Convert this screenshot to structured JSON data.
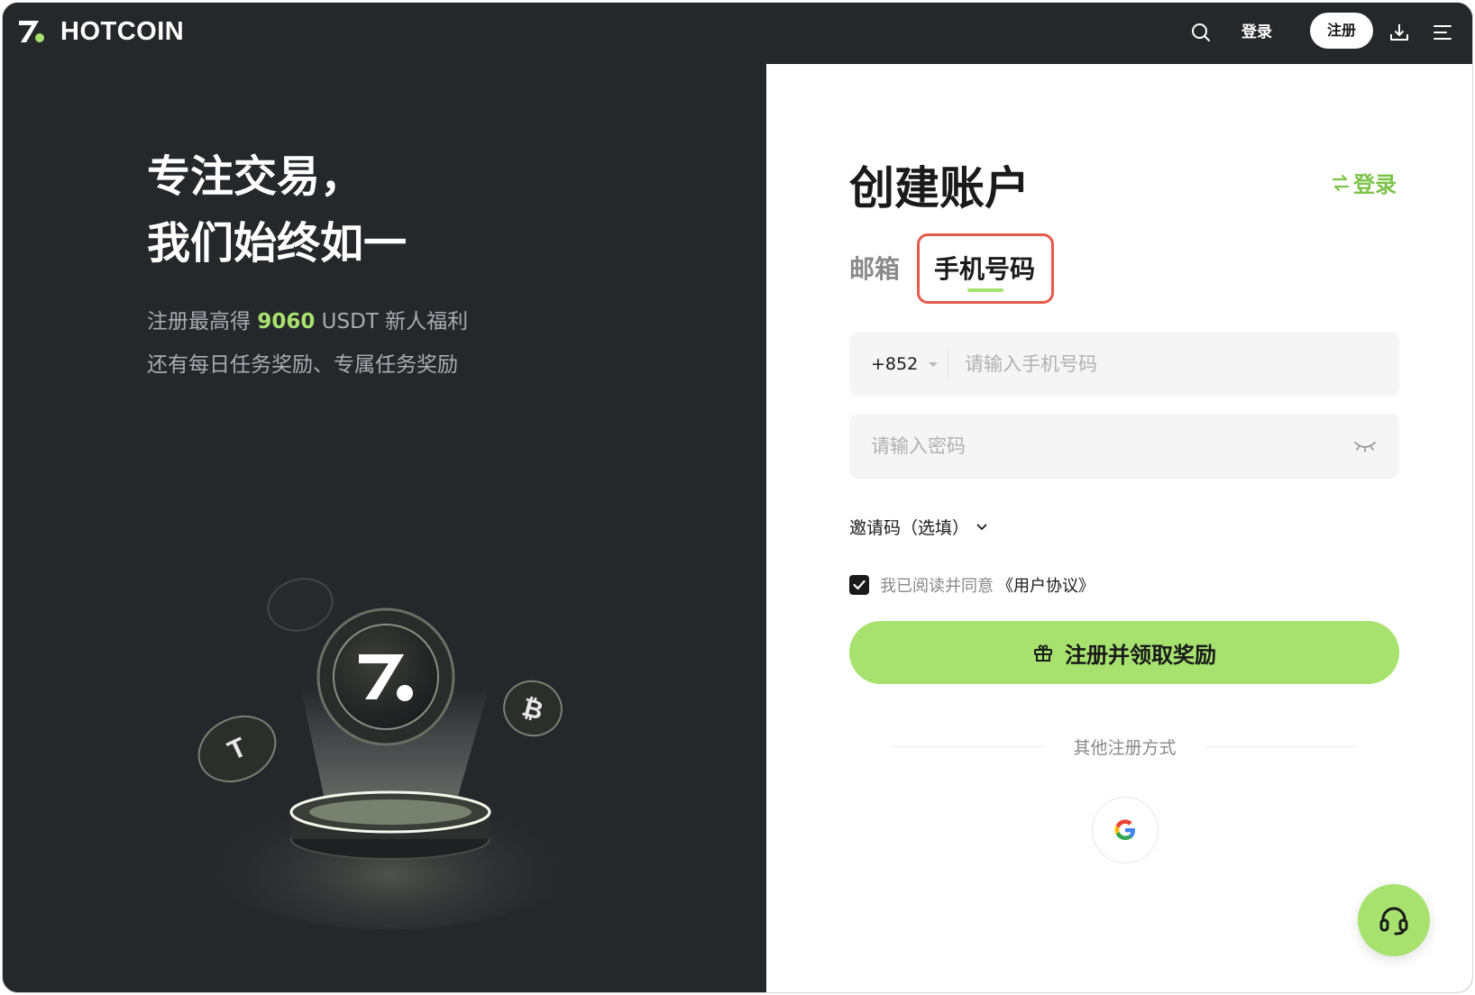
{
  "header": {
    "logo_text": "HOTCOIN",
    "login_label": "登录",
    "register_label": "注册",
    "icons": [
      "search-icon",
      "download-icon",
      "menu-icon"
    ]
  },
  "promo": {
    "headline_line1": "专注交易，",
    "headline_line2": "我们始终如一",
    "sub_prefix": "注册最高得 ",
    "sub_amount": "9060",
    "sub_suffix": " USDT 新人福利",
    "sub_line2": "还有每日任务奖励、专属任务奖励"
  },
  "form": {
    "title": "创建账户",
    "switch_login": "登录",
    "tab_email": "邮箱",
    "tab_phone": "手机号码",
    "country_code": "+852",
    "phone_placeholder": "请输入手机号码",
    "password_placeholder": "请输入密码",
    "invite_label": "邀请码（选填）",
    "agree_text": "我已阅读并同意",
    "agree_link": "《用户协议》",
    "submit_label": "注册并领取奖励",
    "other_methods": "其他注册方式"
  },
  "colors": {
    "accent": "#a7e26f",
    "dark_bg": "#26272b",
    "highlight_border": "#e45a4b"
  }
}
